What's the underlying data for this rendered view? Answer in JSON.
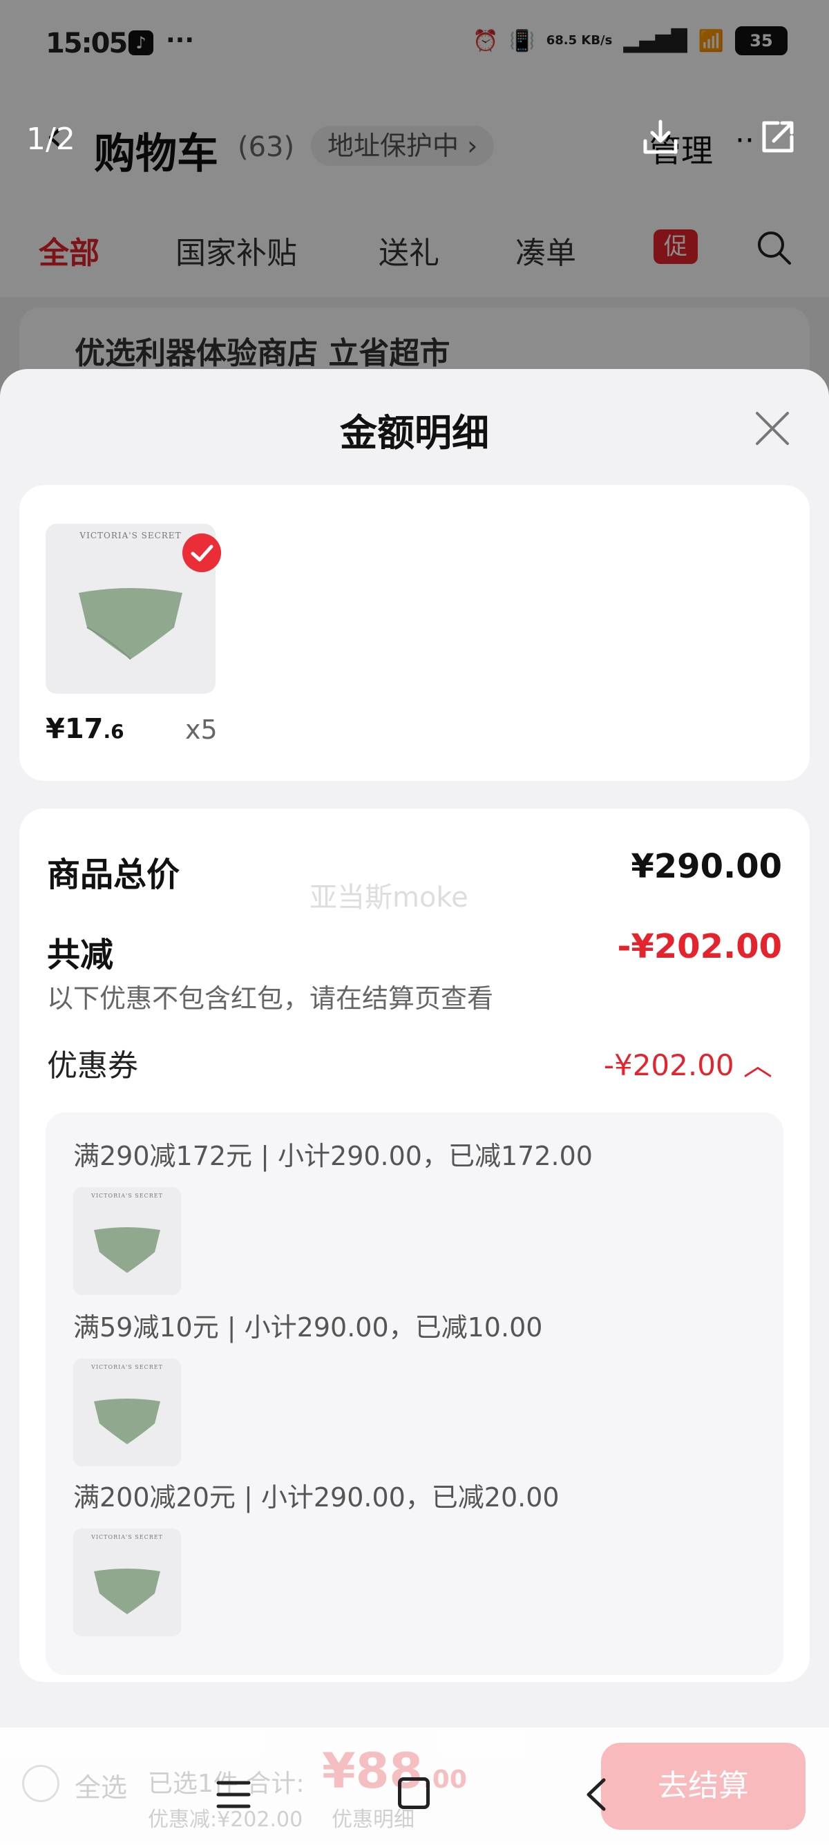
{
  "status_bar": {
    "time": "15:05",
    "more": "···",
    "speed": "68.5 KB/s",
    "battery": "35"
  },
  "viewer": {
    "counter": "1/2"
  },
  "header": {
    "title": "购物车",
    "count": "(63)",
    "address_chip": "地址保护中 ›",
    "manage": "管理",
    "more": "··"
  },
  "tabs": [
    {
      "label": "全部"
    },
    {
      "label": "国家补贴"
    },
    {
      "label": "送礼"
    },
    {
      "label": "凑单"
    }
  ],
  "tab_badge": "促",
  "store_card": {
    "text": "优选利器体验商店 立省超市"
  },
  "sheet": {
    "title": "金额明细",
    "product": {
      "brand": "VICTORIA'S SECRET",
      "price_int": "¥17",
      "price_dec": ".6",
      "quantity": "x5"
    },
    "watermark": "亚当斯moke",
    "rows": {
      "total_label": "商品总价",
      "total_value": "¥290.00",
      "reduce_label": "共减",
      "reduce_value": "-¥202.00",
      "reduce_note": "以下优惠不包含红包，请在结算页查看",
      "coupon_label": "优惠券",
      "coupon_value": "-¥202.00 ︿"
    },
    "coupons": [
      {
        "text": "满290减172元 | 小计290.00，已减172.00"
      },
      {
        "text": "满59减10元 | 小计290.00，已减10.00"
      },
      {
        "text": "满200减20元 | 小计290.00，已减20.00"
      }
    ]
  },
  "footer": {
    "select_all": "全选",
    "selected": "已选1件 合计:",
    "total": "¥88",
    "total_dec": ".00",
    "saved": "优惠减:¥202.00",
    "detail": "优惠明细",
    "checkout": "去结算"
  },
  "colors": {
    "accent": "#e5232d",
    "product_green": "#8fa88e"
  }
}
